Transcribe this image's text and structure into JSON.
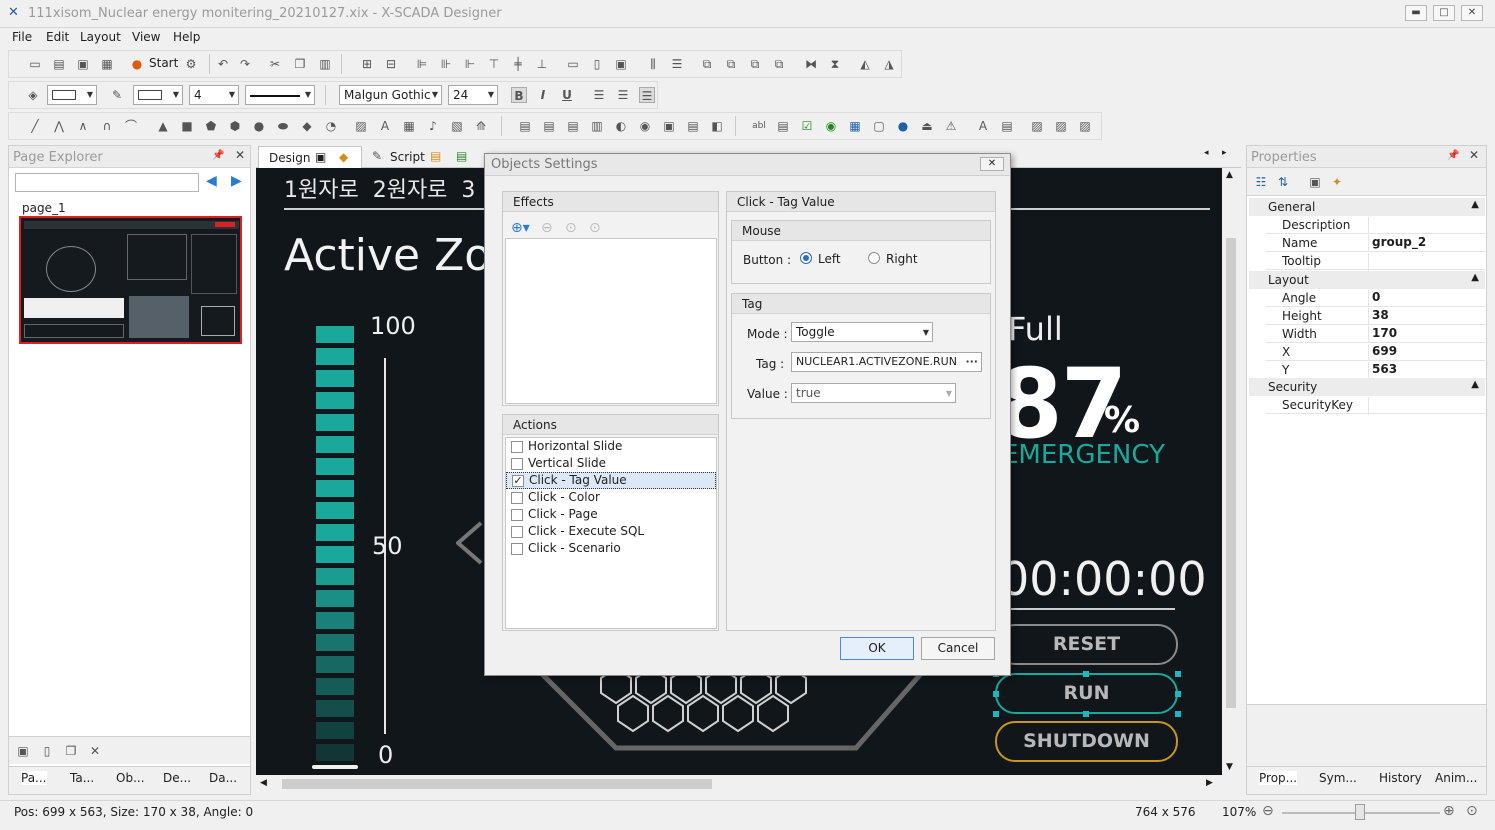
{
  "window": {
    "title": "111xisom_Nuclear energy monitering_20210127.xix - X-SCADA Designer",
    "minimize": "▬",
    "maximize": "□",
    "close": "✕"
  },
  "menu": [
    "File",
    "Edit",
    "Layout",
    "View",
    "Help"
  ],
  "toolbar": {
    "start_label": "Start",
    "font_family": "Malgun Gothic",
    "font_size": "24",
    "line_width": "4",
    "bold": "B",
    "italic": "I",
    "underline": "U"
  },
  "page_explorer": {
    "title": "Page Explorer",
    "search_value": "",
    "page_label": "page_1",
    "bottom_tabs": [
      "Pa...",
      "Ta...",
      "Ob...",
      "De...",
      "Da..."
    ]
  },
  "editor": {
    "tabs": [
      "Design",
      "Script"
    ]
  },
  "canvas": {
    "zones": "1원자로  2원자로  3",
    "title": "Active Zo",
    "scale_top": "100",
    "scale_mid": "50",
    "scale_bottom": "0",
    "full_label": "Full",
    "percent": "87",
    "percent_sign": "%",
    "status": "EMERGENCY",
    "timer": "00:00:00",
    "reset": "RESET",
    "run": "RUN",
    "shutdown": "SHUTDOWN",
    "accent": "#1aa89c"
  },
  "dialog": {
    "title": "Objects Settings",
    "close": "✕",
    "effects_label": "Effects",
    "actions_label": "Actions",
    "actions": [
      {
        "label": "Horizontal Slide",
        "checked": false
      },
      {
        "label": "Vertical Slide",
        "checked": false
      },
      {
        "label": "Click - Tag Value",
        "checked": true
      },
      {
        "label": "Click - Color",
        "checked": false
      },
      {
        "label": "Click - Page",
        "checked": false
      },
      {
        "label": "Click - Execute SQL",
        "checked": false
      },
      {
        "label": "Click - Scenario",
        "checked": false
      }
    ],
    "right_header": "Click - Tag Value",
    "mouse_label": "Mouse",
    "button_label": "Button :",
    "left": "Left",
    "right": "Right",
    "tag_group": "Tag",
    "mode_label": "Mode :",
    "mode_value": "Toggle",
    "tag_label": "Tag :",
    "tag_value": "NUCLEAR1.ACTIVEZONE.RUN",
    "ellipsis": "···",
    "value_label": "Value :",
    "value_value": "true",
    "ok": "OK",
    "cancel": "Cancel"
  },
  "properties": {
    "title": "Properties",
    "general": "General",
    "layout": "Layout",
    "security": "Security",
    "rows_general": [
      {
        "k": "Description",
        "v": ""
      },
      {
        "k": "Name",
        "v": "group_2"
      },
      {
        "k": "Tooltip",
        "v": ""
      }
    ],
    "rows_layout": [
      {
        "k": "Angle",
        "v": "0"
      },
      {
        "k": "Height",
        "v": "38"
      },
      {
        "k": "Width",
        "v": "170"
      },
      {
        "k": "X",
        "v": "699"
      },
      {
        "k": "Y",
        "v": "563"
      }
    ],
    "rows_security": [
      {
        "k": "SecurityKey",
        "v": ""
      }
    ],
    "bottom_tabs": [
      "Prop...",
      "Sym...",
      "History",
      "Anim..."
    ]
  },
  "status": {
    "pos": "Pos: 699 x 563, Size: 170 x 38, Angle: 0",
    "canvas_size": "764 x 576",
    "zoom": "107%"
  }
}
